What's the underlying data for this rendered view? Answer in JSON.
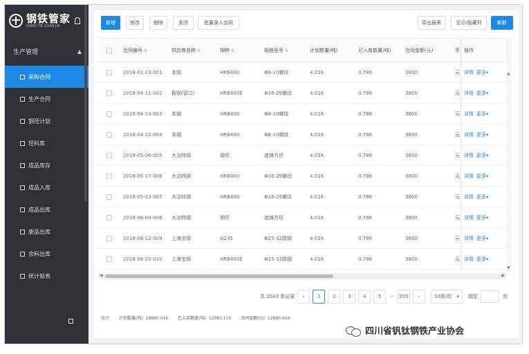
{
  "colors": {
    "accent": "#1e88e5",
    "sidebar_bg": "#2e3135"
  },
  "brand": {
    "name": "钢铁管家",
    "subtitle": "GANG TIE GUAN JIA",
    "logo_icon": "globe-logo-icon",
    "bell_icon": "bell-icon"
  },
  "sidebar": {
    "group_label": "生产管理",
    "items": [
      {
        "label": "采购合同",
        "active": true
      },
      {
        "label": "生产合同",
        "active": false
      },
      {
        "label": "钢坯计划",
        "active": false
      },
      {
        "label": "坯料库",
        "active": false
      },
      {
        "label": "成品库存",
        "active": false
      },
      {
        "label": "成品入库",
        "active": false
      },
      {
        "label": "成品出库",
        "active": false
      },
      {
        "label": "废品出库",
        "active": false
      },
      {
        "label": "余料出库",
        "active": false
      },
      {
        "label": "统计报表",
        "active": false
      }
    ]
  },
  "toolbar": {
    "buttons": [
      "新增",
      "修改",
      "删除",
      "关闭",
      "批量录入合同"
    ],
    "right_buttons": [
      "导出报表",
      "显示/隐藏列",
      "刷新"
    ]
  },
  "table": {
    "headers": [
      "合同编号",
      "供应商名称",
      "钢种",
      "规格型号",
      "计划数量(吨)",
      "已入库数量(吨)",
      "合同金额(元)",
      "币",
      "操作"
    ],
    "rows": [
      [
        "2018-01-23-001",
        "本钢",
        "HRB400",
        "Φ8-10螺纹",
        "4.016",
        "0.786",
        "3800",
        "元"
      ],
      [
        "2018-04-11-002",
        "鞍钢(营口)",
        "HRB400E",
        "Φ16-25螺纹",
        "4.016",
        "0.786",
        "3800",
        "元"
      ],
      [
        "2018-04-14-003",
        "本钢",
        "HRB400",
        "Φ8-10螺纹",
        "4.016",
        "0.786",
        "3800",
        "元"
      ],
      [
        "2018-04-22-004",
        "本钢",
        "HRB400",
        "Φ8-10螺纹",
        "4.016",
        "0.786",
        "3800",
        "元"
      ],
      [
        "2018-05-06-005",
        "大冶特钢",
        "钢坯",
        "连铸方坯",
        "4.016",
        "0.786",
        "3800",
        "元"
      ],
      [
        "2018-05-17-006",
        "大冶特钢",
        "HRB400",
        "Φ16-25螺纹",
        "4.016",
        "0.786",
        "3800",
        "元"
      ],
      [
        "2018-05-23-007",
        "大冶特钢",
        "HRB400",
        "Φ16-25螺纹",
        "4.016",
        "0.786",
        "3800",
        "元"
      ],
      [
        "2018-06-04-008",
        "大冶特钢",
        "钢坯",
        "连铸方坯",
        "4.016",
        "0.786",
        "3800",
        "元"
      ],
      [
        "2018-06-12-009",
        "上海宝钢",
        "Q235",
        "Φ25-32圆钢",
        "4.016",
        "0.786",
        "3800",
        "元"
      ],
      [
        "2018-06-20-010",
        "上海宝钢",
        "HRB400E",
        "Φ25-32圆钢",
        "4.016",
        "0.786",
        "3800",
        "元"
      ]
    ],
    "action_labels": [
      "详情",
      "更多"
    ]
  },
  "pagination": {
    "total_label": "共 2043 条记录",
    "pages": [
      "1",
      "2",
      "3",
      "4",
      "5"
    ],
    "ellipsis": "···",
    "last_page": "205",
    "page_size": "10条/页",
    "jump_label": "跳至",
    "page_suffix": "页"
  },
  "summary": {
    "total_label": "合计",
    "items": [
      "计划数量(吨): 18880.416",
      "已入库数量(吨): 12880.116",
      "合同金额(元): 12880.416"
    ]
  },
  "watermark": {
    "text": "四川省钒钛钢铁产业协会",
    "icon": "wechat-icon"
  }
}
